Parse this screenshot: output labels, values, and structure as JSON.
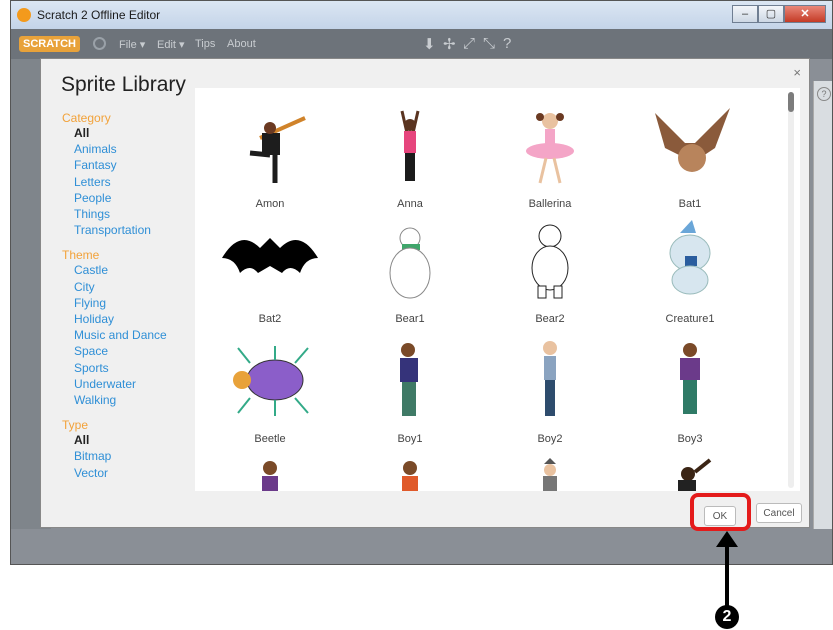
{
  "window": {
    "title": "Scratch 2 Offline Editor",
    "min": "–",
    "max": "▢",
    "close": "✕"
  },
  "menubar": {
    "logo": "SCRATCH",
    "items": [
      "File ▾",
      "Edit ▾",
      "Tips",
      "About"
    ]
  },
  "dialog": {
    "title": "Sprite Library",
    "close": "×",
    "category_heading": "Category",
    "categories": [
      "All",
      "Animals",
      "Fantasy",
      "Letters",
      "People",
      "Things",
      "Transportation"
    ],
    "theme_heading": "Theme",
    "themes": [
      "Castle",
      "City",
      "Flying",
      "Holiday",
      "Music and Dance",
      "Space",
      "Sports",
      "Underwater",
      "Walking"
    ],
    "type_heading": "Type",
    "types": [
      "All",
      "Bitmap",
      "Vector"
    ],
    "sprites": [
      "Amon",
      "Anna",
      "Ballerina",
      "Bat1",
      "Bat2",
      "Bear1",
      "Bear2",
      "Creature1",
      "Beetle",
      "Boy1",
      "Boy2",
      "Boy3"
    ],
    "ok_label": "OK",
    "cancel_label": "Cancel"
  },
  "annotation": {
    "step": "2",
    "highlight_color": "#e41b1b"
  }
}
